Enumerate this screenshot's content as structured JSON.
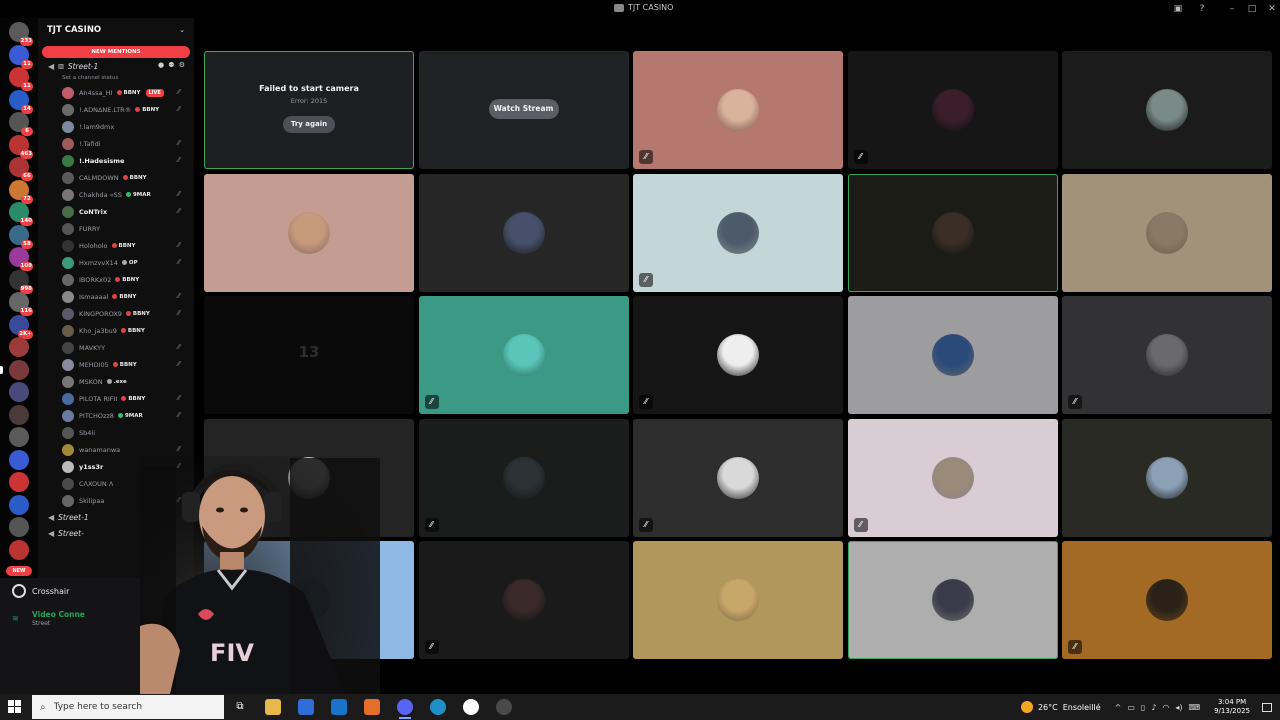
{
  "window": {
    "title": "TJT CASINO"
  },
  "sidebar": {
    "server_name": "TJT CASINO",
    "new_mentions_label": "NEW MENTIONS",
    "channel": {
      "name": "Street-1",
      "status_placeholder": "Set a channel status"
    },
    "members": [
      {
        "name": "An4ssa_HI",
        "tag": "BBNY",
        "live": "LIVE",
        "color": "#c45b6a"
      },
      {
        "name": "!.ADNΔNE.LTR®",
        "tag": "BBNY",
        "color": "#6b6b6b"
      },
      {
        "name": "!.lam9dmx",
        "tag": "",
        "color": "#7b8aa0"
      },
      {
        "name": "!.Tafidi",
        "tag": "",
        "color": "#a05a5a"
      },
      {
        "name": "!.Hadesisme",
        "tag": "",
        "color": "#3b7a46",
        "bright": true
      },
      {
        "name": "CALMDOWN",
        "tag": "BBNY",
        "color": "#5a5a5a"
      },
      {
        "name": "Chakhda «SS",
        "tag": "9MAR",
        "tag_color": "green",
        "color": "#777"
      },
      {
        "name": "CoNTrix",
        "tag": "",
        "color": "#4a6b4a",
        "bright": true
      },
      {
        "name": "FURRY",
        "tag": "",
        "color": "#555"
      },
      {
        "name": "Holoholo",
        "tag": "BBNY",
        "color": "#333"
      },
      {
        "name": "HxmzvvX14",
        "tag": "OP",
        "tag_color": "gray",
        "color": "#3a9a7a"
      },
      {
        "name": "IBORKx02",
        "tag": "BBNY",
        "color": "#666"
      },
      {
        "name": "Ismaaaal",
        "tag": "BBNY",
        "color": "#888"
      },
      {
        "name": "KINGPOROX9",
        "tag": "BBNY",
        "color": "#5a5a6a"
      },
      {
        "name": "Kho_ja3bu9",
        "tag": "BBNY",
        "color": "#6a5a4a"
      },
      {
        "name": "MAVKYY",
        "tag": "",
        "color": "#444"
      },
      {
        "name": "MEHDI05",
        "tag": "BBNY",
        "color": "#8a8aa0"
      },
      {
        "name": "MSKON",
        "tag": ".exe",
        "tag_color": "gray",
        "color": "#777"
      },
      {
        "name": "PILOTA RIFII",
        "tag": "BBNY",
        "color": "#4a6aa0"
      },
      {
        "name": "PITCHOzz8",
        "tag": "9MAR",
        "tag_color": "green",
        "color": "#6a7aa0"
      },
      {
        "name": "Sb4ii",
        "tag": "",
        "color": "#555"
      },
      {
        "name": "wanamanwa",
        "tag": "",
        "color": "#a08a3a"
      },
      {
        "name": "y1ss3r",
        "tag": "",
        "color": "#bbb",
        "bright": true
      },
      {
        "name": "CΛXOUN Λ",
        "tag": "",
        "color": "#4a4a4a"
      },
      {
        "name": "Skilipaa",
        "tag": "",
        "color": "#666"
      }
    ],
    "other_channels": [
      "Street-1",
      "Street-"
    ]
  },
  "voice_panel": {
    "activity": "Crosshair",
    "connection_label": "Video Conne",
    "connection_sub": "Street"
  },
  "servers": {
    "badges": [
      "233",
      "11",
      "11",
      "14",
      "6",
      "463",
      "66",
      "72",
      "140",
      "58",
      "109",
      "998",
      "116",
      "2K+"
    ],
    "new_label": "NEW"
  },
  "grid": {
    "failed_title": "Failed to start camera",
    "failed_error": "Error: 2015",
    "try_again_label": "Try again",
    "watch_stream_label": "Watch Stream",
    "placeholder_text": "13",
    "tiles": [
      {
        "kind": "failed",
        "bg": "#1e1f22",
        "speaking": true
      },
      {
        "kind": "stream",
        "bg": "#202124"
      },
      {
        "kind": "avatar",
        "bg": "#b5786f",
        "avatar": "#d9b39b",
        "muted": true
      },
      {
        "kind": "avatar",
        "bg": "#161617",
        "avatar": "#3a1f2a",
        "muted": true
      },
      {
        "kind": "avatar",
        "bg": "#1b1b1c",
        "avatar": "#7a8a86"
      },
      {
        "kind": "avatar",
        "bg": "#c49c92",
        "avatar": "#c89a7c"
      },
      {
        "kind": "avatar",
        "bg": "#262626",
        "avatar": "#46506a"
      },
      {
        "kind": "avatar",
        "bg": "#c5d6d8",
        "avatar": "#4d5a6a",
        "muted": true
      },
      {
        "kind": "avatar",
        "bg": "#1a1c15",
        "avatar": "#3a2e25",
        "speaking": true
      },
      {
        "kind": "avatar",
        "bg": "#a3927a",
        "avatar": "#8a7a65"
      },
      {
        "kind": "placeholder",
        "bg": "#0a0a0a"
      },
      {
        "kind": "avatar",
        "bg": "#3a9a86",
        "avatar": "#5ac5b8",
        "muted": true
      },
      {
        "kind": "avatar",
        "bg": "#151515",
        "avatar": "#eeeeee",
        "muted": true
      },
      {
        "kind": "avatar",
        "bg": "#9d9d9f",
        "avatar": "#2a4a7a"
      },
      {
        "kind": "avatar",
        "bg": "#323234",
        "avatar": "#6a6a6e",
        "muted": true
      },
      {
        "kind": "avatar",
        "bg": "#242424",
        "avatar": "#e8e8e8"
      },
      {
        "kind": "avatar",
        "bg": "#1b1d1d",
        "avatar": "#2a3235",
        "muted": true
      },
      {
        "kind": "avatar",
        "bg": "#2d2d2e",
        "avatar": "#d9d9d9",
        "muted": true
      },
      {
        "kind": "avatar",
        "bg": "#d9cdd5",
        "avatar": "#9a8a7a",
        "muted": true
      },
      {
        "kind": "avatar",
        "bg": "#2a2a24",
        "avatar": "#8aa0b5"
      },
      {
        "kind": "avatar",
        "bg": "#8db9e4",
        "avatar": "#6aa0c8"
      },
      {
        "kind": "avatar",
        "bg": "#1a1a1a",
        "avatar": "#3a2a2a",
        "muted": true
      },
      {
        "kind": "avatar",
        "bg": "#b2975c",
        "avatar": "#c8a86a"
      },
      {
        "kind": "avatar",
        "bg": "#aeaeae",
        "avatar": "#3a3a4a",
        "speaking": true
      },
      {
        "kind": "avatar",
        "bg": "#a36a25",
        "avatar": "#2a2218",
        "muted": true
      }
    ]
  },
  "taskbar": {
    "search_placeholder": "Type here to search",
    "temperature": "26°C",
    "weather": "Ensoleillé",
    "time": "3:04 PM",
    "date": "9/13/2025"
  }
}
